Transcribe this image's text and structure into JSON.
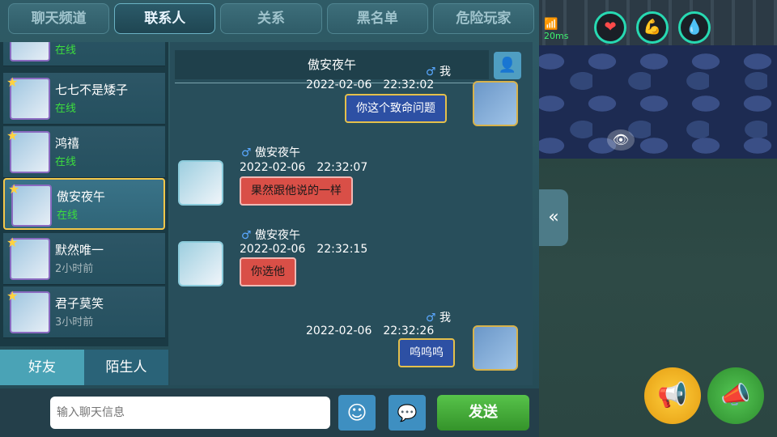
{
  "tabs": [
    {
      "label": "聊天频道"
    },
    {
      "label": "联系人"
    },
    {
      "label": "关系"
    },
    {
      "label": "黑名单"
    },
    {
      "label": "危险玩家"
    }
  ],
  "contacts": [
    {
      "name": "",
      "status": "在线"
    },
    {
      "name": "七七不是矮子",
      "status": "在线"
    },
    {
      "name": "鸿禧",
      "status": "在线"
    },
    {
      "name": "傲安夜午",
      "status": "在线"
    },
    {
      "name": "默然唯一",
      "status": "2小时前"
    },
    {
      "name": "君子莫笑",
      "status": "3小时前"
    }
  ],
  "bottom_tabs": {
    "friends": "好友",
    "strangers": "陌生人"
  },
  "chat": {
    "header": "傲安夜午",
    "messages": [
      {
        "sender": "我",
        "time": "2022-02-06　22:32:02",
        "text": "你这个致命问题"
      },
      {
        "sender": "傲安夜午",
        "time": "2022-02-06　22:32:07",
        "text": "果然跟他说的一样"
      },
      {
        "sender": "傲安夜午",
        "time": "2022-02-06　22:32:15",
        "text": "你选他"
      },
      {
        "sender": "我",
        "time": "2022-02-06　22:32:26",
        "text": "呜呜呜"
      }
    ]
  },
  "input": {
    "placeholder": "输入聊天信息",
    "send_label": "发送"
  },
  "hud": {
    "ping": "20ms"
  },
  "icons": {
    "gender": "male-icon",
    "profile": "user-icon",
    "emoji": "smiley-icon",
    "quick_chat": "speech-bubble-icon",
    "collapse": "double-chevron-left-icon",
    "eye": "eye-icon",
    "heart": "heart-icon",
    "strength": "arm-icon",
    "water": "drop-icon",
    "megaphone_yellow": "megaphone-icon",
    "megaphone_green": "megaphone-icon"
  },
  "colors": {
    "accent": "#f3c74a",
    "online": "#3dde3d",
    "send": "#57c34a"
  }
}
